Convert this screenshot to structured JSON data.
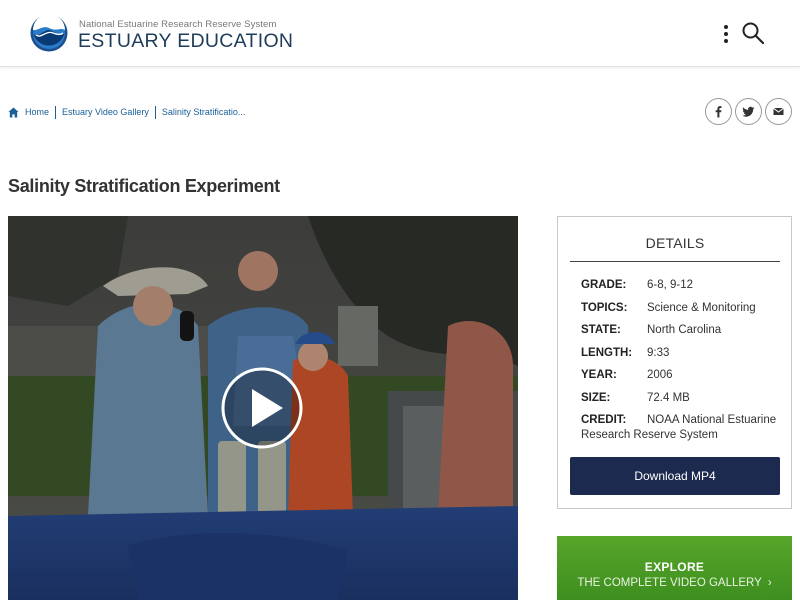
{
  "header": {
    "org": "National Estuarine Research Reserve System",
    "title": "ESTUARY EDUCATION",
    "logo_icon": "noaa-logo-icon",
    "menu_icon": "kebab-menu-icon",
    "search_icon": "search-icon"
  },
  "breadcrumb": {
    "items": [
      "Home",
      "Estuary Video Gallery",
      "Salinity Stratificatio..."
    ]
  },
  "share": {
    "facebook_icon": "facebook-icon",
    "twitter_icon": "twitter-icon",
    "email_icon": "email-icon"
  },
  "page": {
    "title": "Salinity Stratification Experiment"
  },
  "video": {
    "play_icon": "play-icon"
  },
  "details": {
    "title": "DETAILS",
    "rows": [
      {
        "label": "GRADE:",
        "value": "6-8, 9-12"
      },
      {
        "label": "TOPICS:",
        "value": "Science & Monitoring"
      },
      {
        "label": "STATE:",
        "value": "North Carolina"
      },
      {
        "label": "LENGTH:",
        "value": "9:33"
      },
      {
        "label": "YEAR:",
        "value": "2006"
      },
      {
        "label": "SIZE:",
        "value": "72.4 MB"
      },
      {
        "label": "CREDIT:",
        "value": "NOAA National Estuarine Research Reserve System"
      }
    ],
    "download_label": "Download MP4"
  },
  "explore": {
    "title": "EXPLORE",
    "subtitle": "THE COMPLETE VIDEO GALLERY",
    "chevron_icon": "chevron-right-icon"
  },
  "colors": {
    "title_blue": "#1f3c5a",
    "link_blue": "#1a5f97",
    "download_bg": "#1c2a4f",
    "explore_green": "#4a9a24"
  }
}
